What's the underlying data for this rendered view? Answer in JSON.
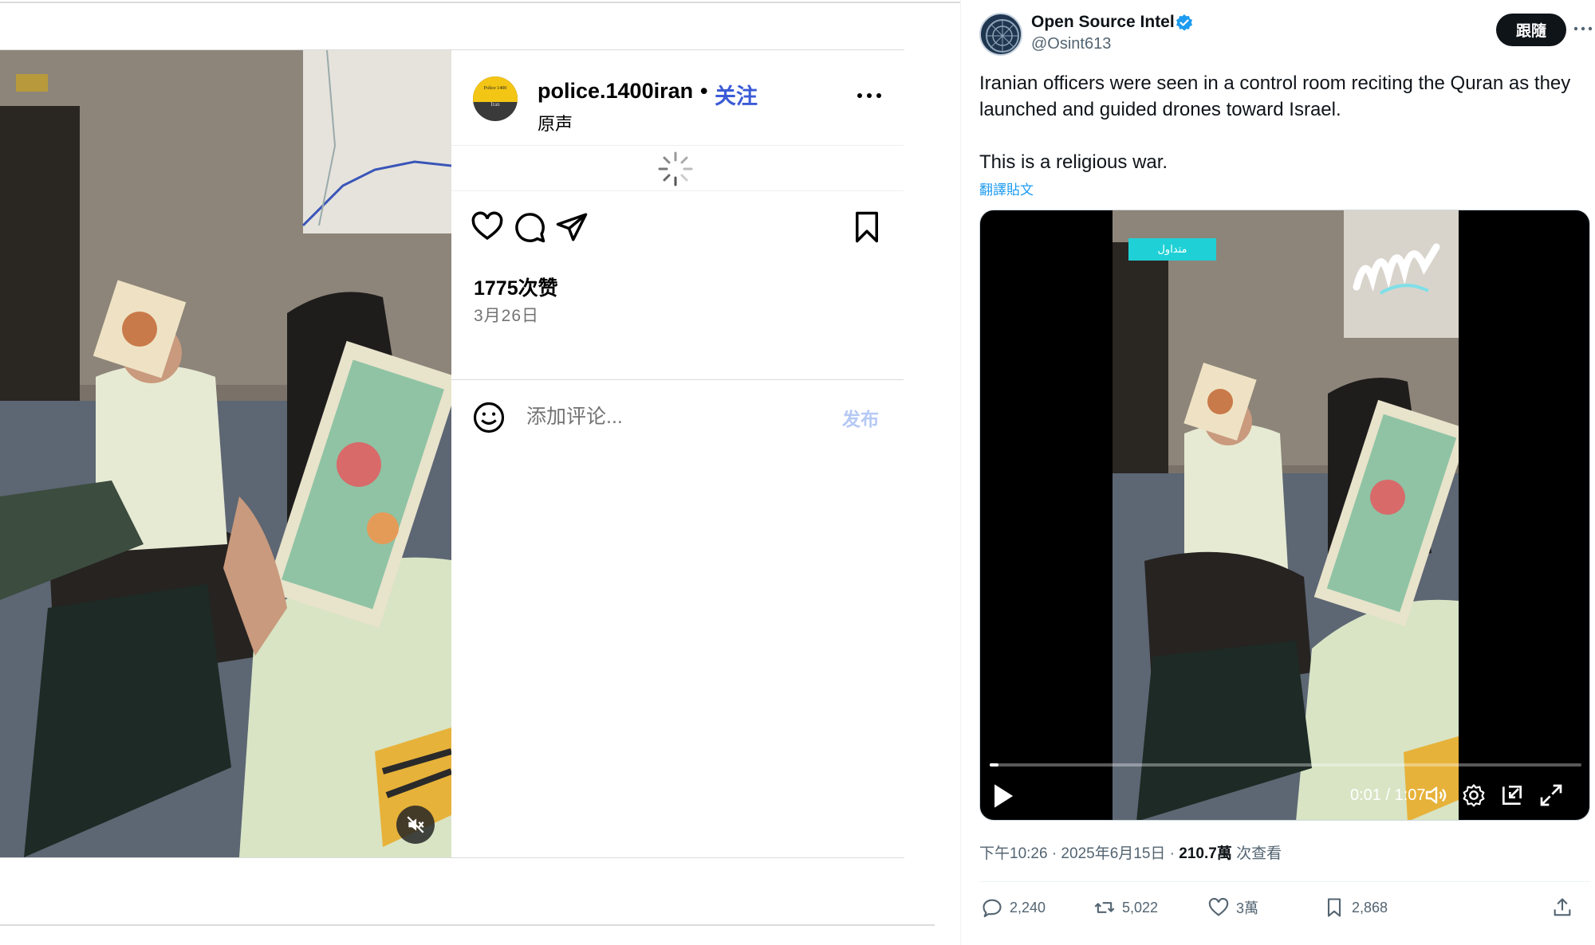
{
  "instagram": {
    "username": "police.1400iran",
    "separator": "•",
    "follow_label": "关注",
    "audio_label": "原声",
    "avatar_text_top": "Police 1400",
    "avatar_text_bottom": "Iran",
    "likes": "1775次赞",
    "date": "3月26日",
    "comment_placeholder": "添加评论...",
    "post_label": "发布",
    "icons": [
      "more-icon",
      "loading-spinner",
      "heart-icon",
      "comment-icon",
      "share-icon",
      "bookmark-icon",
      "emoji-icon",
      "muted-icon"
    ]
  },
  "tweet": {
    "author_name": "Open Source Intel",
    "handle": "@Osint613",
    "follow_label": "跟隨",
    "text_line1": "Iranian officers were seen in a control room reciting the Quran as they launched and guided drones toward Israel.",
    "text_line2": "This is a religious war.",
    "translate_label": "翻譯貼文",
    "video": {
      "tag_text": "متداول",
      "time": "0:01 / 1:07",
      "progress": 0.015
    },
    "meta_time": "下午10:26 · 2025年6月15日 · ",
    "meta_views": "210.7萬",
    "meta_views_suffix": " 次查看",
    "stats": {
      "replies": "2,240",
      "reposts": "5,022",
      "likes": "3萬",
      "bookmarks": "2,868"
    },
    "icons": [
      "verified-badge-icon",
      "more-icon",
      "play-icon",
      "volume-icon",
      "settings-icon",
      "pip-icon",
      "fullscreen-icon",
      "reply-icon",
      "repost-icon",
      "like-icon",
      "bookmark-icon",
      "share-icon"
    ]
  },
  "colors": {
    "ig_follow": "#3b5bd6",
    "ig_post": "#b5c9f5",
    "tw_link": "#1d9bf0",
    "tw_secondary": "#536471"
  }
}
